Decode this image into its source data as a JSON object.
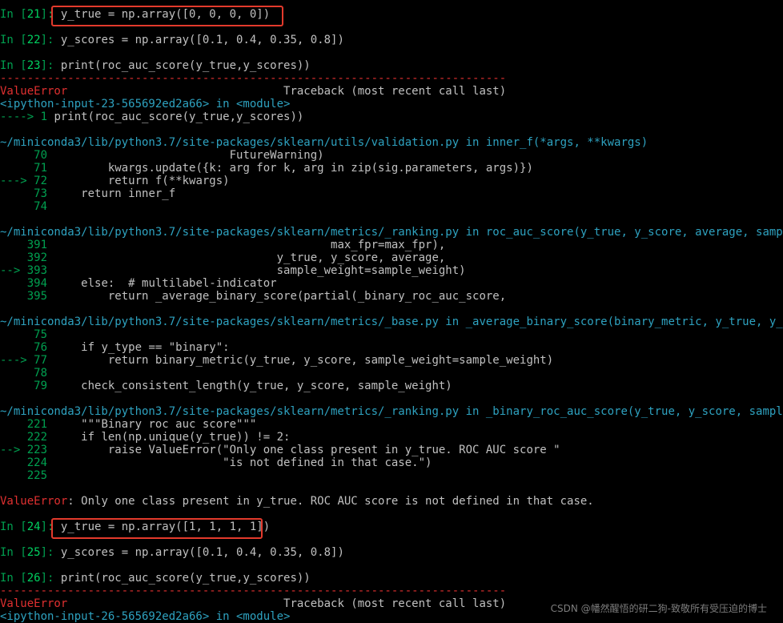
{
  "colors": {
    "background": "#000000",
    "prompt": "#00a050",
    "error": "#e03030",
    "path": "#2ea2c0",
    "highlight_box": "#e33a2c"
  },
  "terminal": {
    "lines": [
      "In [21]: y_true = np.array([0, 0, 0, 0])",
      "",
      "In [22]: y_scores = np.array([0.1, 0.4, 0.35, 0.8])",
      "",
      "In [23]: print(roc_auc_score(y_true,y_scores))",
      "---------------------------------------------------------------------------",
      "ValueError                                Traceback (most recent call last)",
      "<ipython-input-23-565692ed2a66> in <module>",
      "----> 1 print(roc_auc_score(y_true,y_scores))",
      "",
      "~/miniconda3/lib/python3.7/site-packages/sklearn/utils/validation.py in inner_f(*args, **kwargs)",
      "     70                           FutureWarning)",
      "     71         kwargs.update({k: arg for k, arg in zip(sig.parameters, args)})",
      "---> 72         return f(**kwargs)",
      "     73     return inner_f",
      "     74",
      "",
      "~/miniconda3/lib/python3.7/site-packages/sklearn/metrics/_ranking.py in roc_auc_score(y_true, y_score, average, sample_weight, max_fpr, multi_class, labels)",
      "    391                                          max_fpr=max_fpr),",
      "    392                                  y_true, y_score, average,",
      "--> 393                                  sample_weight=sample_weight)",
      "    394     else:  # multilabel-indicator",
      "    395         return _average_binary_score(partial(_binary_roc_auc_score,",
      "",
      "~/miniconda3/lib/python3.7/site-packages/sklearn/metrics/_base.py in _average_binary_score(binary_metric, y_true, y_score, average, sample_weight)",
      "     75",
      "     76     if y_type == \"binary\":",
      "---> 77         return binary_metric(y_true, y_score, sample_weight=sample_weight)",
      "     78",
      "     79     check_consistent_length(y_true, y_score, sample_weight)",
      "",
      "~/miniconda3/lib/python3.7/site-packages/sklearn/metrics/_ranking.py in _binary_roc_auc_score(y_true, y_score, sample_weight)",
      "    221     \"\"\"Binary roc auc score\"\"\"",
      "    222     if len(np.unique(y_true)) != 2:",
      "--> 223         raise ValueError(\"Only one class present in y_true. ROC AUC score \"",
      "    224                          \"is not defined in that case.\")",
      "    225",
      "",
      "ValueError: Only one class present in y_true. ROC AUC score is not defined in that case.",
      "",
      "In [24]: y_true = np.array([1, 1, 1, 1])",
      "",
      "In [25]: y_scores = np.array([0.1, 0.4, 0.35, 0.8])",
      "",
      "In [26]: print(roc_auc_score(y_true,y_scores))",
      "---------------------------------------------------------------------------",
      "ValueError                                Traceback (most recent call last)",
      "<ipython-input-26-565692ed2a66> in <module>"
    ]
  },
  "watermark": "CSDN @幡然醒悟的研二狗-致敬所有受压迫的博士"
}
